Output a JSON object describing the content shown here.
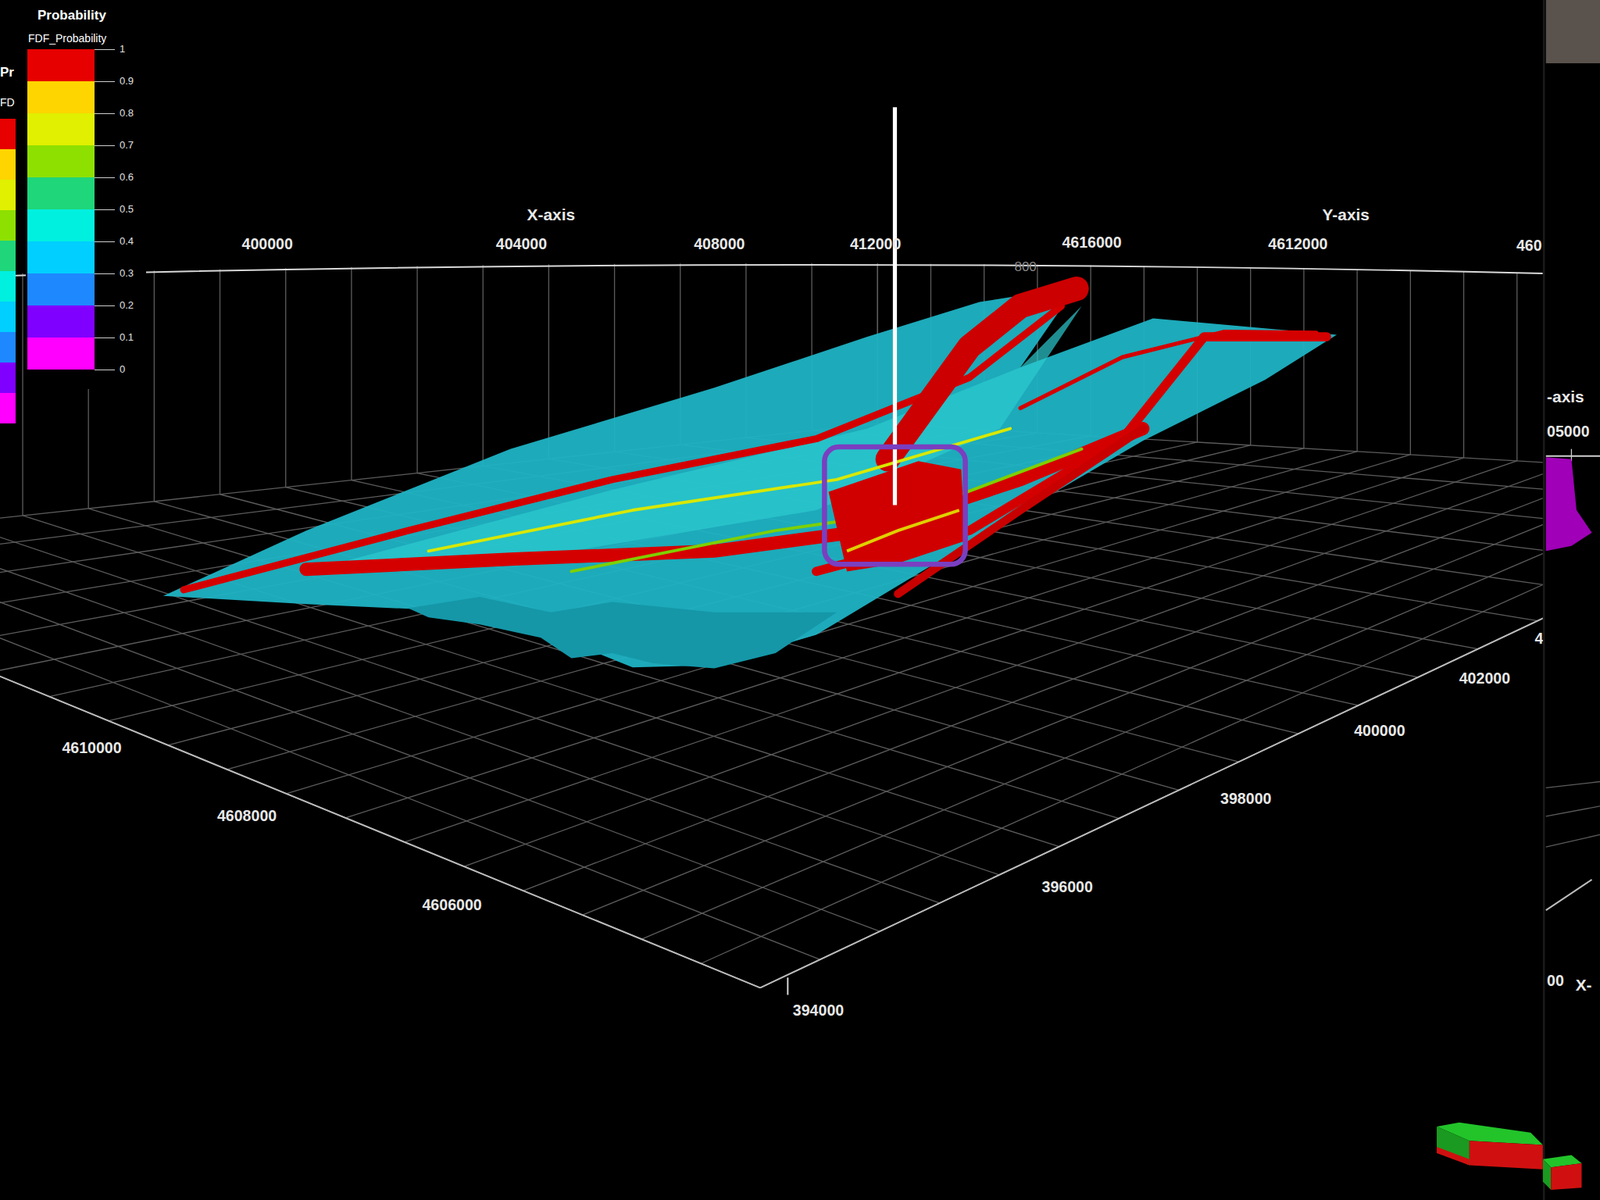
{
  "legend": {
    "title": "Probability",
    "variable": "FDF_Probability",
    "ticks": [
      "1",
      "0.9",
      "0.8",
      "0.7",
      "0.6",
      "0.5",
      "0.4",
      "0.3",
      "0.2",
      "0.1",
      "0"
    ],
    "bands": [
      {
        "color": "#e60000"
      },
      {
        "color": "#ffd500"
      },
      {
        "color": "#e0f000"
      },
      {
        "color": "#8ee000"
      },
      {
        "color": "#1fd67a"
      },
      {
        "color": "#00f0e0"
      },
      {
        "color": "#00cfff"
      },
      {
        "color": "#1e88ff"
      },
      {
        "color": "#8000ff"
      },
      {
        "color": "#ff00ff"
      }
    ]
  },
  "back_legend": {
    "title": "Pr",
    "variable": "FD"
  },
  "axes": {
    "x_title": "X-axis",
    "y_title": "Y-axis",
    "top_ticks": [
      "400000",
      "404000",
      "408000",
      "412000",
      "4616000",
      "4612000",
      "460"
    ],
    "depth_label": "800",
    "left_ticks": [
      "4610000",
      "4608000",
      "4606000"
    ],
    "right_ticks": [
      "394000",
      "396000",
      "398000",
      "400000",
      "402000",
      "4"
    ]
  },
  "side_view": {
    "axis_title": "-axis",
    "tick": "05000",
    "bottom_tick": "00",
    "bottom_axis": "X-"
  }
}
